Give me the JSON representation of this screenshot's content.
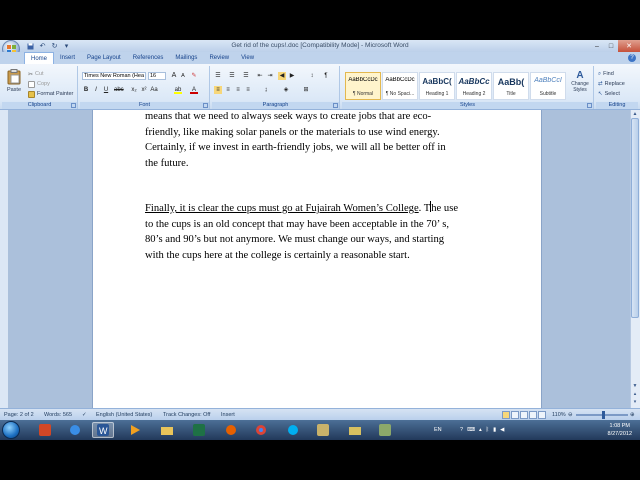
{
  "window": {
    "title": "Get rid of the cups!.doc [Compatibility Mode] - Microsoft Word"
  },
  "quick_access": {
    "undo": "↶",
    "redo": "↻",
    "save": "💾"
  },
  "window_controls": {
    "minimize": "–",
    "maximize": "□",
    "close": "✕"
  },
  "ribbon_tabs": [
    "Home",
    "Insert",
    "Page Layout",
    "References",
    "Mailings",
    "Review",
    "View"
  ],
  "clipboard": {
    "paste": "Paste",
    "cut": "Cut",
    "copy": "Copy",
    "format_painter": "Format Painter",
    "label": "Clipboard"
  },
  "font": {
    "family": "Times New Roman (Hea",
    "size": "16",
    "grow": "A",
    "shrink": "A",
    "label": "Font"
  },
  "font_buttons": {
    "bold": "B",
    "italic": "I",
    "underline": "U"
  },
  "paragraph": {
    "label": "Paragraph"
  },
  "styles": {
    "label": "Styles",
    "items": [
      {
        "sample": "AaBbCcDc",
        "name": "¶ Normal"
      },
      {
        "sample": "AaBbCcDc",
        "name": "¶ No Spaci..."
      },
      {
        "sample": "AaBbC(",
        "name": "Heading 1"
      },
      {
        "sample": "AaBbCc",
        "name": "Heading 2"
      },
      {
        "sample": "AaBb(",
        "name": "Title"
      },
      {
        "sample": "AaBbCcI",
        "name": "Subtitle"
      }
    ],
    "change_styles": "Change Styles"
  },
  "editing": {
    "find": "Find",
    "replace": "Replace",
    "select": "Select",
    "label": "Editing"
  },
  "document": {
    "para1_lines": [
      "means that we need to always seek ways to create jobs  that are  eco-",
      "friendly, like making solar panels or the materials to use wind energy.",
      "Certainly, if we invest in earth-friendly jobs, we will all be better off in",
      "the future."
    ],
    "para2_underlined": "Finally, it is clear the cups must go at Fujairah Women’s College",
    "para2_after_underline": ".  T",
    "para2_after_caret": "he use",
    "para2_lines": [
      "to the cups is an old concept that may have been acceptable in the 70’ s,",
      "80’s and  90’s but not anymore.  We must change our ways, and starting",
      "with the cups here at the college is certainly a reasonable start."
    ]
  },
  "status": {
    "page": "Page: 2 of 2",
    "words": "Words: 565",
    "language": "English (United States)",
    "track_changes": "Track Changes: Off",
    "insert": "Insert",
    "zoom": "110%"
  },
  "taskbar": {
    "lang": "EN",
    "time": "1:08 PM",
    "date": "8/27/2012"
  }
}
